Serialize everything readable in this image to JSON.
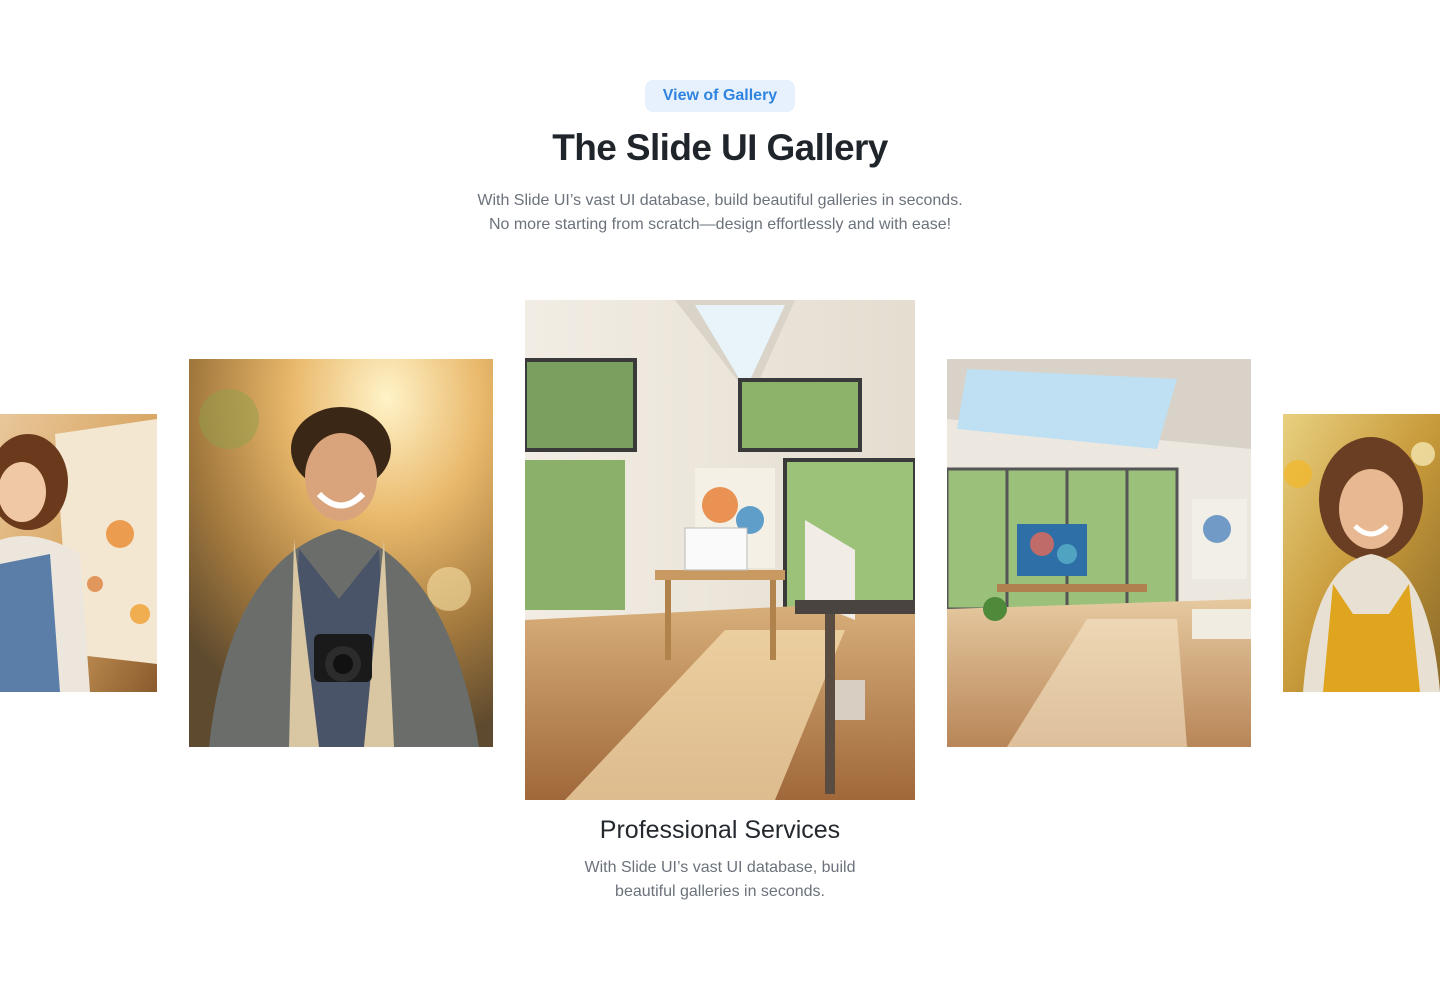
{
  "header": {
    "badge_label": "View of Gallery",
    "title": "The Slide UI Gallery",
    "subtitle_line1": "With Slide UI’s vast UI database, build beautiful galleries in seconds.",
    "subtitle_line2": "No more starting from scratch—design effortlessly and with ease!"
  },
  "gallery": {
    "slides": [
      {
        "image": "woman-painter-at-easel-photo"
      },
      {
        "image": "smiling-man-with-camera-photo"
      },
      {
        "image": "sunlit-art-studio-photo"
      },
      {
        "image": "art-studio-with-skylights-photo"
      },
      {
        "image": "smiling-woman-in-yellow-overalls-photo"
      }
    ],
    "active_index": 2,
    "caption_title": "Professional Services",
    "caption_text": "With Slide UI’s vast UI database, build beautiful galleries in seconds."
  },
  "colors": {
    "accent": "#2f84e0",
    "badge_bg": "#e7f1fd",
    "heading": "#1f252b",
    "body_text": "#6b727b"
  }
}
